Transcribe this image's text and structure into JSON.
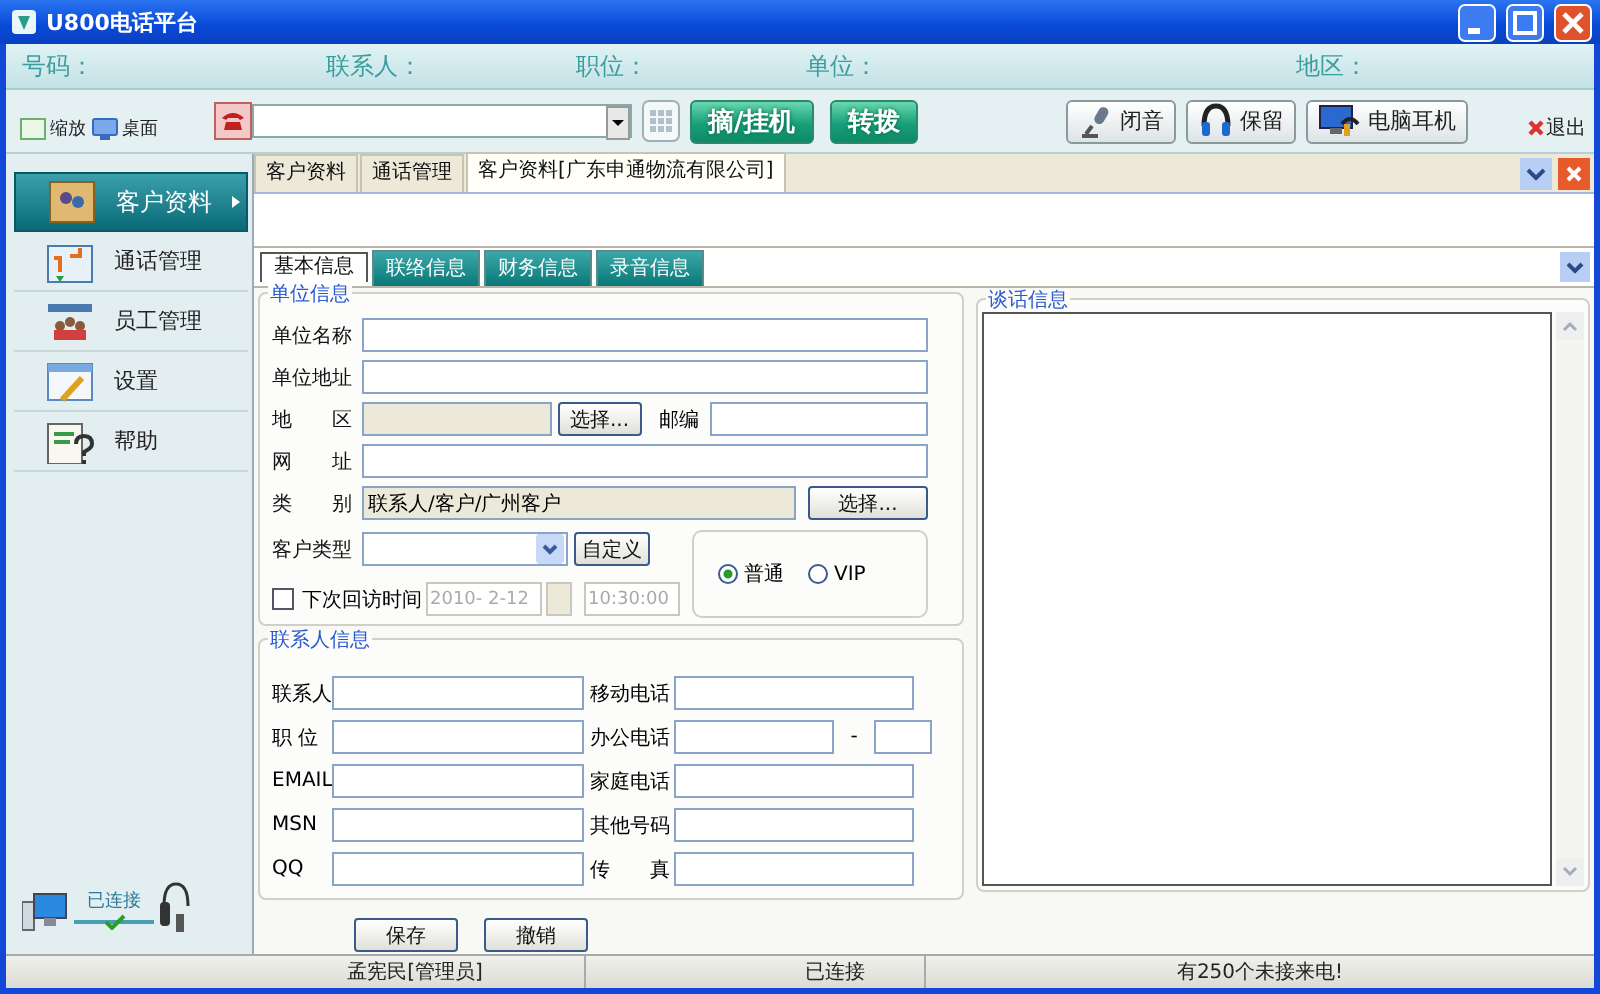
{
  "window": {
    "title": "U800电话平台"
  },
  "info_bar": [
    "号码：",
    "联系人：",
    "职位：",
    "单位：",
    "地区："
  ],
  "toolbar": {
    "view_options": [
      "缩放",
      "桌面"
    ],
    "call_buttons": [
      "摘/挂机",
      "转拨"
    ],
    "audio_buttons": [
      "闭音",
      "保留",
      "电脑耳机"
    ],
    "exit": "退出"
  },
  "sidebar": {
    "items": [
      {
        "label": "客户资料",
        "selected": true
      },
      {
        "label": "通话管理",
        "selected": false
      },
      {
        "label": "员工管理",
        "selected": false
      },
      {
        "label": "设置",
        "selected": false
      },
      {
        "label": "帮助",
        "selected": false
      }
    ],
    "connection": "已连接"
  },
  "doc_tabs": [
    {
      "label": "客户资料",
      "selected": false
    },
    {
      "label": "通话管理",
      "selected": false
    },
    {
      "label": "客户资料[广东申通物流有限公司]",
      "selected": true
    }
  ],
  "form_tabs": [
    {
      "label": "基本信息",
      "selected": true
    },
    {
      "label": "联络信息",
      "selected": false
    },
    {
      "label": "财务信息",
      "selected": false
    },
    {
      "label": "录音信息",
      "selected": false
    }
  ],
  "unit_info": {
    "title": "单位信息",
    "rows": [
      {
        "kind": "text",
        "label": "单位名称"
      },
      {
        "kind": "text",
        "label": "单位地址"
      },
      {
        "kind": "region",
        "label": "地 区",
        "button": "选择...",
        "postcode_label": "邮编"
      },
      {
        "kind": "text",
        "label": "网 址"
      },
      {
        "kind": "category",
        "label": "类 别",
        "value": "联系人/客户/广州客户",
        "button": "选择..."
      }
    ],
    "customer_type": {
      "label": "客户类型",
      "button": "自定义"
    },
    "next_visit": {
      "label": "下次回访时间",
      "checked": false,
      "date": "2010- 2-12",
      "time": "10:30:00"
    },
    "level_options": [
      {
        "label": "普通",
        "selected": true
      },
      {
        "label": "VIP",
        "selected": false
      }
    ]
  },
  "contact_info": {
    "title": "联系人信息",
    "rows": [
      {
        "left": "联系人",
        "right": "移动电话"
      },
      {
        "left": "职 位",
        "right": "办公电话",
        "extension": "-"
      },
      {
        "left": "EMAIL",
        "right": "家庭电话"
      },
      {
        "left": "MSN",
        "right": "其他号码"
      },
      {
        "left": "QQ",
        "right": "传 真"
      }
    ]
  },
  "actions": [
    "保存",
    "撤销"
  ],
  "chat": {
    "title": "谈话信息"
  },
  "status_bar": [
    "孟宪民[管理员]",
    "已连接",
    "有250个未接来电!"
  ]
}
